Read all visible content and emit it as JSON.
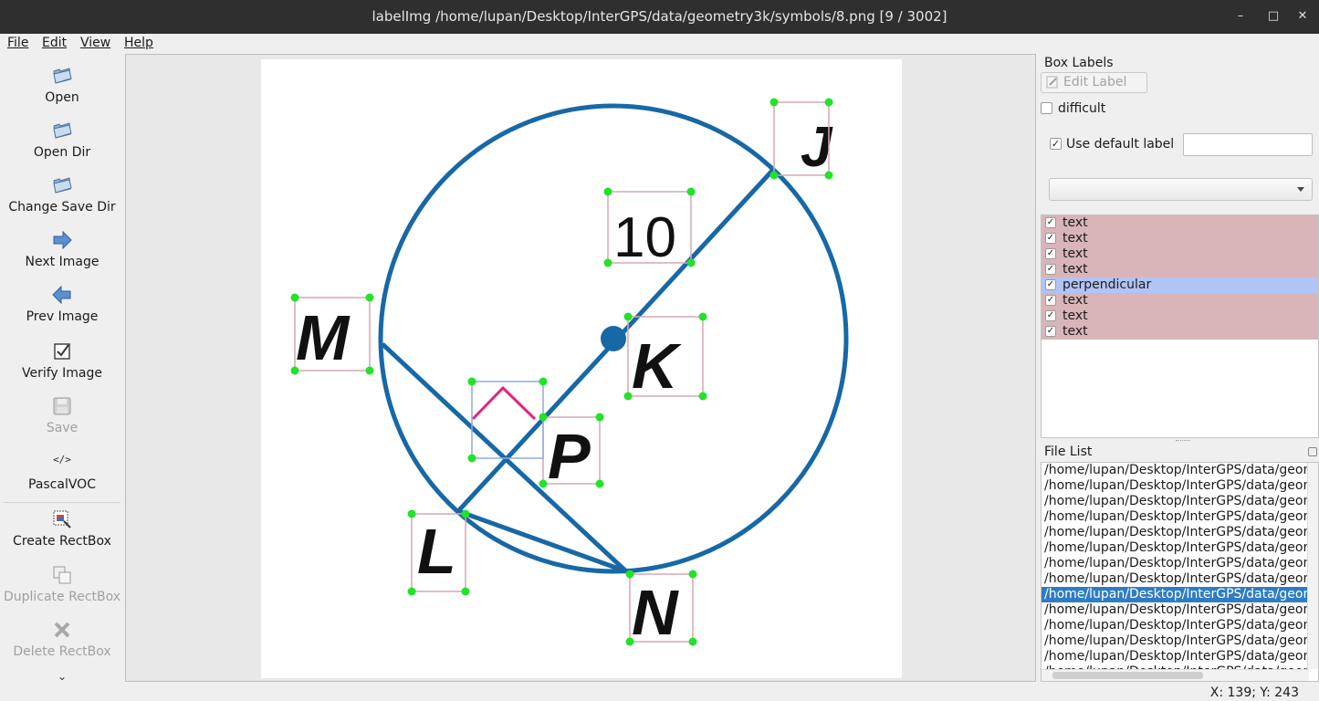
{
  "window": {
    "title": "labelImg /home/lupan/Desktop/InterGPS/data/geometry3k/symbols/8.png [9 / 3002]",
    "minimize": "–",
    "maximize": "□",
    "close": "✕"
  },
  "menu": {
    "file": "File",
    "edit": "Edit",
    "view": "View",
    "help": "Help"
  },
  "toolbar": {
    "open": "Open",
    "open_dir": "Open Dir",
    "change_save_dir": "Change Save Dir",
    "next_image": "Next Image",
    "prev_image": "Prev Image",
    "verify_image": "Verify Image",
    "save": "Save",
    "format_icon": "</>",
    "format": "PascalVOC",
    "create_rectbox": "Create RectBox",
    "duplicate_rectbox": "Duplicate RectBox",
    "delete_rectbox": "Delete RectBox",
    "more": "⌄"
  },
  "image": {
    "labels": {
      "J": "J",
      "ten": "10",
      "M": "M",
      "K": "K",
      "P": "P",
      "L": "L",
      "N": "N"
    },
    "colors": {
      "geometry": "#1768a6",
      "box": "#d9a7b0",
      "selected_box": "#8fa8e6",
      "handle": "#22e22a",
      "right_angle": "#e0257a"
    }
  },
  "box_labels": {
    "title": "Box Labels",
    "edit_label": "Edit Label",
    "difficult": "difficult",
    "use_default_label": "Use default label",
    "default_label_value": "",
    "items": [
      {
        "label": "text",
        "checked": true,
        "color": "#d9b5b9"
      },
      {
        "label": "text",
        "checked": true,
        "color": "#d9b5b9"
      },
      {
        "label": "text",
        "checked": true,
        "color": "#d9b5b9"
      },
      {
        "label": "text",
        "checked": true,
        "color": "#d9b5b9"
      },
      {
        "label": "perpendicular",
        "checked": true,
        "color": "#b1c4f7"
      },
      {
        "label": "text",
        "checked": true,
        "color": "#d9b5b9"
      },
      {
        "label": "text",
        "checked": true,
        "color": "#d9b5b9"
      },
      {
        "label": "text",
        "checked": true,
        "color": "#d9b5b9"
      }
    ]
  },
  "file_list": {
    "title": "File List",
    "selected_index": 8,
    "items": [
      "/home/lupan/Desktop/InterGPS/data/geom",
      "/home/lupan/Desktop/InterGPS/data/geom",
      "/home/lupan/Desktop/InterGPS/data/geom",
      "/home/lupan/Desktop/InterGPS/data/geom",
      "/home/lupan/Desktop/InterGPS/data/geom",
      "/home/lupan/Desktop/InterGPS/data/geom",
      "/home/lupan/Desktop/InterGPS/data/geom",
      "/home/lupan/Desktop/InterGPS/data/geom",
      "/home/lupan/Desktop/InterGPS/data/geom",
      "/home/lupan/Desktop/InterGPS/data/geom",
      "/home/lupan/Desktop/InterGPS/data/geom",
      "/home/lupan/Desktop/InterGPS/data/geom",
      "/home/lupan/Desktop/InterGPS/data/geom",
      "/home/lupan/Desktop/InterGPS/data/geom"
    ]
  },
  "status": {
    "coords": "X: 139; Y: 243"
  }
}
